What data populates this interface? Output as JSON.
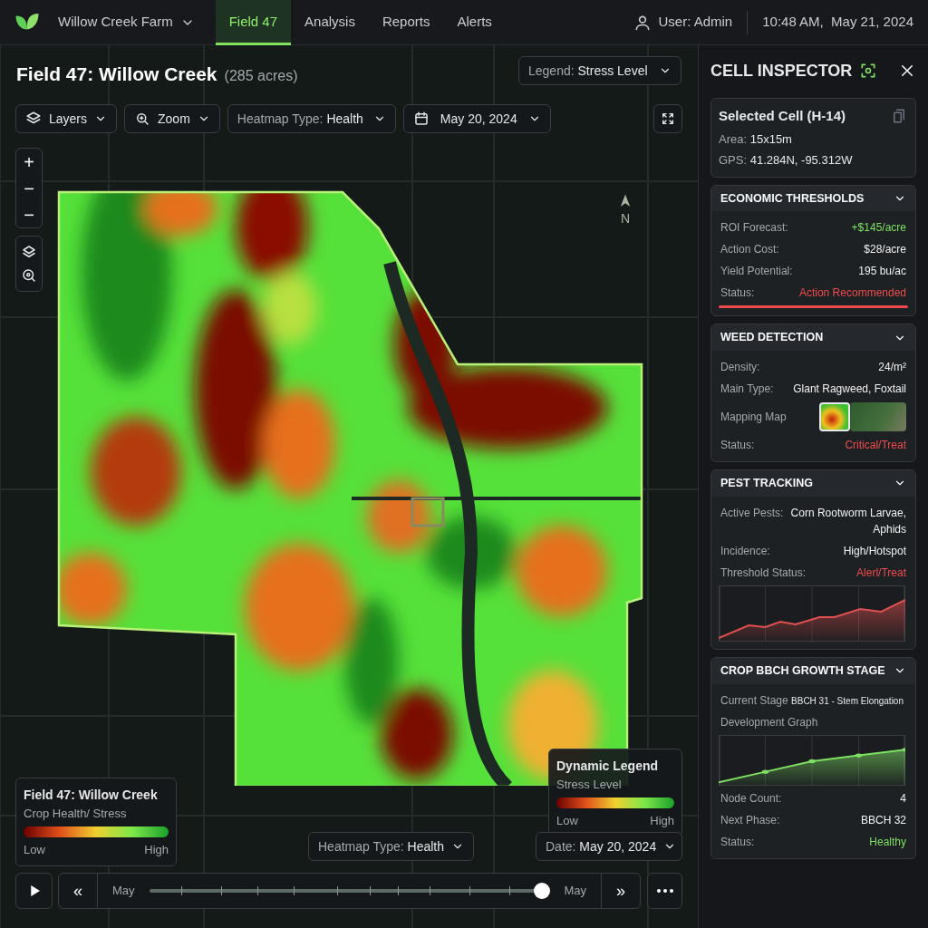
{
  "nav": {
    "brand": "Willow Creek Farm",
    "tabs": [
      {
        "label": "Field 47",
        "selected": true
      },
      {
        "label": "Analysis",
        "selected": false
      },
      {
        "label": "Reports",
        "selected": false
      },
      {
        "label": "Alerts",
        "selected": false
      }
    ],
    "user": "User: Admin",
    "datetime": "10:48 AM,  May 21, 2024"
  },
  "map": {
    "title": "Field 47: Willow Creek",
    "subtitle": "(285 acres)",
    "legend_select": {
      "label": "Legend:",
      "value": "Stress Level"
    },
    "toolbar": [
      {
        "kind": "layers",
        "label": "Layers"
      },
      {
        "kind": "zoom",
        "label": "Zoom"
      },
      {
        "kind": "select",
        "label": "Heatmap Type:",
        "value": "Health"
      },
      {
        "kind": "date",
        "label": "May 20, 2024"
      }
    ],
    "zoom_controls": [
      "+",
      "−",
      "−"
    ],
    "compass": "N",
    "field_legend": {
      "title": "Field 47: Willow Creek",
      "subtitle": "Crop Health/ Stress",
      "low": "Low",
      "high": "High"
    },
    "dynamic_legend": {
      "title": "Dynamic Legend",
      "subtitle": "Stress Level",
      "low": "Low",
      "high": "High"
    },
    "heatmap_select": {
      "label": "Heatmap Type:",
      "value": "Health"
    },
    "date_select": {
      "label": "Date:",
      "value": "May 20, 2024"
    },
    "timeline": {
      "rewind": "«",
      "start": "May",
      "end": "May",
      "forward": "»",
      "level": 0.98
    }
  },
  "inspector": {
    "title": "CELL INSPECTOR",
    "cell": {
      "title": "Selected Cell (H-14)",
      "rows": [
        {
          "label": "Area:",
          "value": "15x15m"
        },
        {
          "label": "GPS:",
          "value": "41.284N, -95.312W"
        }
      ]
    },
    "sections": [
      {
        "title": "ECONOMIC THRESHOLDS",
        "expanded": true,
        "rows": [
          {
            "kind": "pair",
            "label": "ROI Forecast:",
            "value": "+$145/acre",
            "color": "#7ee063"
          },
          {
            "kind": "pair",
            "label": "Action Cost:",
            "value": "$28/acre",
            "color": "#f0f1f2"
          },
          {
            "kind": "pair",
            "label": "Yield Potential:",
            "value": "195 bu/ac",
            "color": "#f0f1f2"
          },
          {
            "kind": "pair",
            "label": "Status:",
            "value": "Action Recommended",
            "color": "#ef4b4b"
          },
          {
            "kind": "rule",
            "color": "#ef4b4b"
          }
        ]
      },
      {
        "title": "WEED DETECTION",
        "expanded": true,
        "rows": [
          {
            "kind": "pair",
            "label": "Density:",
            "value": "24/m²",
            "color": "#f0f1f2"
          },
          {
            "kind": "pair",
            "label": "Main Type:",
            "value": "Glant Ragweed, Foxtail",
            "color": "#f0f1f2"
          },
          {
            "kind": "thumbs",
            "label": "Mapping Map",
            "thumbs": [
              {
                "selected": true
              },
              {
                "selected": false
              }
            ]
          },
          {
            "kind": "pair",
            "label": "Status:",
            "value": "Critical/Treat",
            "color": "#ef4b4b"
          }
        ]
      },
      {
        "title": "PEST TRACKING",
        "expanded": true,
        "rows": [
          {
            "kind": "pair",
            "label": "Active Pests:",
            "value": "Corn Rootworm Larvae, Aphids",
            "color": "#f0f1f2"
          },
          {
            "kind": "pair",
            "label": "Incidence:",
            "value": "High/Hotspot",
            "color": "#f0f1f2"
          },
          {
            "kind": "pair",
            "label": "Threshold Status:",
            "value": "Alerl/Treat",
            "color": "#ef4b4b"
          },
          {
            "kind": "graph",
            "color": "#e05050"
          }
        ]
      },
      {
        "title": "CROP BBCH GROWTH STAGE",
        "expanded": true,
        "rows": [
          {
            "kind": "inline",
            "label": "Current Stage",
            "value": "BBCH 31 - Stem Elongation"
          },
          {
            "kind": "label",
            "label": "Development Graph"
          },
          {
            "kind": "graph",
            "color": "#7ee063"
          },
          {
            "kind": "pair",
            "label": "Node Count:",
            "value": "4",
            "color": "#f0f1f2"
          },
          {
            "kind": "pair",
            "label": "Next Phase:",
            "value": "BBCH 32",
            "color": "#f0f1f2"
          },
          {
            "kind": "pair",
            "label": "Status:",
            "value": "Healthy",
            "color": "#7ee063"
          }
        ]
      }
    ]
  }
}
